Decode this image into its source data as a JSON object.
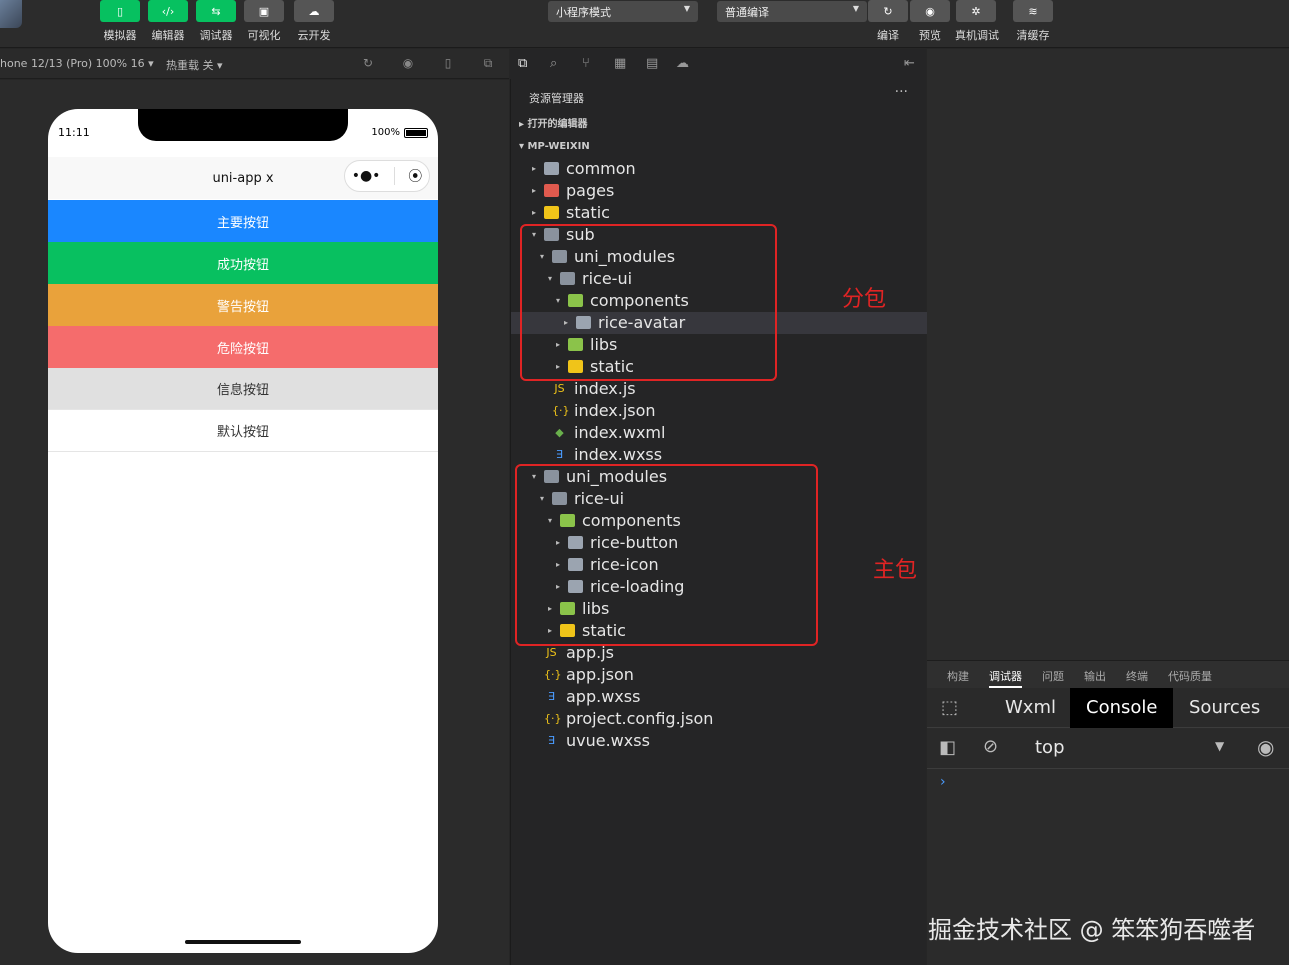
{
  "toolbar": {
    "tools": [
      {
        "icon": "phone-icon",
        "label": "模拟器"
      },
      {
        "icon": "code-icon",
        "label": "编辑器"
      },
      {
        "icon": "debug-icon",
        "label": "调试器"
      },
      {
        "icon": "layout-icon",
        "label": "可视化"
      },
      {
        "icon": "cloud-icon",
        "label": "云开发"
      }
    ],
    "mode_select": "小程序模式",
    "compile_select": "普通编译",
    "actions": [
      {
        "icon": "refresh-icon",
        "label": "编译"
      },
      {
        "icon": "eye-icon",
        "label": "预览"
      },
      {
        "icon": "bug-icon",
        "label": "真机调试"
      },
      {
        "icon": "layers-icon",
        "label": "清缓存"
      }
    ]
  },
  "simulator": {
    "device": "hone 12/13 (Pro) 100% 16 ▾",
    "hot_reload": "热重载 关 ▾",
    "time": "11:11",
    "battery": "100%",
    "nav_title": "uni-app x",
    "buttons": [
      {
        "label": "主要按钮",
        "bg": "#1a87ff",
        "color": "#ffffff"
      },
      {
        "label": "成功按钮",
        "bg": "#08c060",
        "color": "#ffffff"
      },
      {
        "label": "警告按钮",
        "bg": "#e9a23b",
        "color": "#ffffff"
      },
      {
        "label": "危险按钮",
        "bg": "#f56c6c",
        "color": "#ffffff"
      },
      {
        "label": "信息按钮",
        "bg": "#e0e0e0",
        "color": "#333333"
      },
      {
        "label": "默认按钮",
        "bg": "#ffffff",
        "color": "#333333"
      }
    ]
  },
  "explorer": {
    "title": "资源管理器",
    "more": "···",
    "open_editors": "打开的编辑器",
    "project": "MP-WEIXIN",
    "tree": [
      {
        "name": "common",
        "depth": 0,
        "type": "folder",
        "arrow": "▸"
      },
      {
        "name": "pages",
        "depth": 0,
        "type": "folder-red",
        "arrow": "▸"
      },
      {
        "name": "static",
        "depth": 0,
        "type": "folder-yellow",
        "arrow": "▸"
      },
      {
        "name": "sub",
        "depth": 0,
        "type": "folder-open",
        "arrow": "▾"
      },
      {
        "name": "uni_modules",
        "depth": 1,
        "type": "folder-open",
        "arrow": "▾"
      },
      {
        "name": "rice-ui",
        "depth": 2,
        "type": "folder-open",
        "arrow": "▾"
      },
      {
        "name": "components",
        "depth": 3,
        "type": "folder-green",
        "arrow": "▾"
      },
      {
        "name": "rice-avatar",
        "depth": 4,
        "type": "folder",
        "arrow": "▸",
        "selected": true
      },
      {
        "name": "libs",
        "depth": 3,
        "type": "folder-green",
        "arrow": "▸"
      },
      {
        "name": "static",
        "depth": 3,
        "type": "folder-yellow",
        "arrow": "▸"
      },
      {
        "name": "index.js",
        "depth": 1,
        "type": "js"
      },
      {
        "name": "index.json",
        "depth": 1,
        "type": "json"
      },
      {
        "name": "index.wxml",
        "depth": 1,
        "type": "wxml"
      },
      {
        "name": "index.wxss",
        "depth": 1,
        "type": "wxss"
      },
      {
        "name": "uni_modules",
        "depth": 0,
        "type": "folder-open",
        "arrow": "▾"
      },
      {
        "name": "rice-ui",
        "depth": 1,
        "type": "folder-open",
        "arrow": "▾"
      },
      {
        "name": "components",
        "depth": 2,
        "type": "folder-green",
        "arrow": "▾"
      },
      {
        "name": "rice-button",
        "depth": 3,
        "type": "folder",
        "arrow": "▸"
      },
      {
        "name": "rice-icon",
        "depth": 3,
        "type": "folder",
        "arrow": "▸"
      },
      {
        "name": "rice-loading",
        "depth": 3,
        "type": "folder",
        "arrow": "▸"
      },
      {
        "name": "libs",
        "depth": 2,
        "type": "folder-green",
        "arrow": "▸"
      },
      {
        "name": "static",
        "depth": 2,
        "type": "folder-yellow",
        "arrow": "▸"
      },
      {
        "name": "app.js",
        "depth": 0,
        "type": "js"
      },
      {
        "name": "app.json",
        "depth": 0,
        "type": "json"
      },
      {
        "name": "app.wxss",
        "depth": 0,
        "type": "wxss"
      },
      {
        "name": "project.config.json",
        "depth": 0,
        "type": "json"
      },
      {
        "name": "uvue.wxss",
        "depth": 0,
        "type": "wxss"
      }
    ],
    "annotations": {
      "sub_package": "分包",
      "main_package": "主包"
    }
  },
  "debugger": {
    "tabs": [
      "构建",
      "调试器",
      "问题",
      "输出",
      "终端",
      "代码质量"
    ],
    "active_tab": "调试器",
    "panels": [
      "Wxml",
      "Console",
      "Sources"
    ],
    "active_panel": "Console",
    "context": "top",
    "prompt": "›"
  },
  "watermark": "掘金技术社区 @ 笨笨狗吞噬者"
}
